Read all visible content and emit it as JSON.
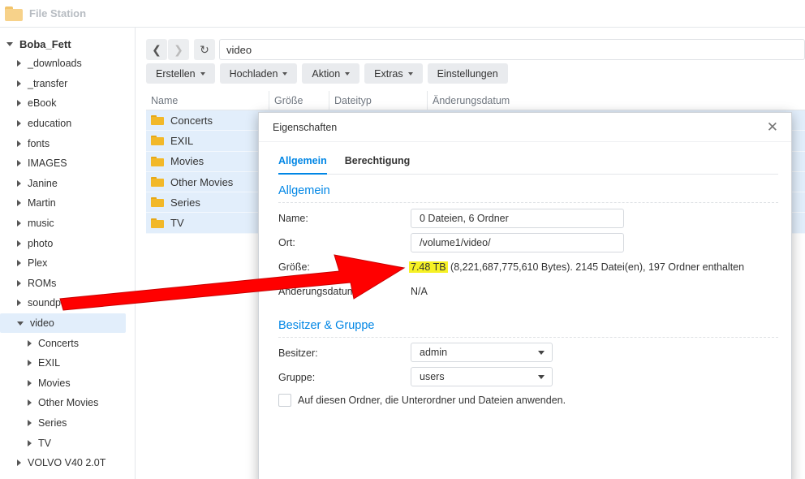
{
  "app": {
    "title": "File Station"
  },
  "sidebar": {
    "root": "Boba_Fett",
    "items": [
      {
        "label": "_downloads",
        "expanded": false
      },
      {
        "label": "_transfer",
        "expanded": false
      },
      {
        "label": "eBook",
        "expanded": false
      },
      {
        "label": "education",
        "expanded": false
      },
      {
        "label": "fonts",
        "expanded": false
      },
      {
        "label": "IMAGES",
        "expanded": false
      },
      {
        "label": "Janine",
        "expanded": false
      },
      {
        "label": "Martin",
        "expanded": false
      },
      {
        "label": "music",
        "expanded": false
      },
      {
        "label": "photo",
        "expanded": false
      },
      {
        "label": "Plex",
        "expanded": false
      },
      {
        "label": "ROMs",
        "expanded": false
      },
      {
        "label": "soundpool",
        "expanded": false
      },
      {
        "label": "video",
        "expanded": true,
        "selected": true
      },
      {
        "label": "Concerts",
        "child": true
      },
      {
        "label": "EXIL",
        "child": true
      },
      {
        "label": "Movies",
        "child": true
      },
      {
        "label": "Other Movies",
        "child": true
      },
      {
        "label": "Series",
        "child": true
      },
      {
        "label": "TV",
        "child": true
      },
      {
        "label": "VOLVO V40 2.0T",
        "expanded": false
      }
    ]
  },
  "path": {
    "value": "video"
  },
  "toolbar": {
    "create": "Erstellen",
    "upload": "Hochladen",
    "action": "Aktion",
    "extras": "Extras",
    "settings": "Einstellungen"
  },
  "columns": {
    "name": "Name",
    "size": "Größe",
    "type": "Dateityp",
    "modified": "Änderungsdatum"
  },
  "files": [
    "Concerts",
    "EXIL",
    "Movies",
    "Other Movies",
    "Series",
    "TV"
  ],
  "dialog": {
    "title": "Eigenschaften",
    "tabs": {
      "general": "Allgemein",
      "permission": "Berechtigung"
    },
    "general_section": "Allgemein",
    "name_label": "Name:",
    "name_value": "0 Dateien, 6 Ordner",
    "location_label": "Ort:",
    "location_value": "/volume1/video/",
    "size_label": "Größe:",
    "size_highlight": "7.48 TB",
    "size_rest": " (8,221,687,775,610 Bytes). 2145 Datei(en), 197 Ordner enthalten",
    "modified_label": "Änderungsdatum:",
    "modified_value": "N/A",
    "owner_section": "Besitzer & Gruppe",
    "owner_label": "Besitzer:",
    "owner_value": "admin",
    "group_label": "Gruppe:",
    "group_value": "users",
    "apply_label": "Auf diesen Ordner, die Unterordner und Dateien anwenden."
  },
  "colors": {
    "accent": "#0086e5",
    "selection": "#e2eefb",
    "highlight": "#f6f125",
    "arrow": "#ff0000"
  }
}
